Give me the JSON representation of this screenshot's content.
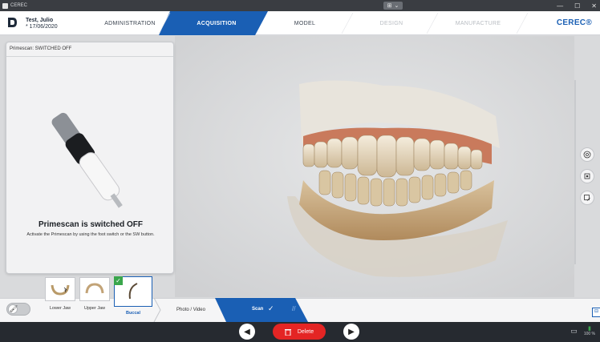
{
  "titlebar": {
    "app_name": "CEREC",
    "min_label": "—",
    "max_label": "☐",
    "close_label": "✕"
  },
  "patient": {
    "name": "Test, Julio",
    "dob": "* 17/06/2020"
  },
  "workflow": {
    "steps": [
      {
        "label": "ADMINISTRATION",
        "state": "normal"
      },
      {
        "label": "ACQUISITION",
        "state": "active"
      },
      {
        "label": "MODEL",
        "state": "normal"
      },
      {
        "label": "DESIGN",
        "state": "disabled"
      },
      {
        "label": "MANUFACTURE",
        "state": "disabled"
      }
    ],
    "brand": "CEREC®"
  },
  "panel": {
    "header": "Primescan: SWITCHED OFF",
    "title": "Primescan is switched OFF",
    "description": "Activate the Primescan by using the foot switch or the SW button."
  },
  "catalog": {
    "items": [
      {
        "label": "Lower Jaw",
        "selected": false
      },
      {
        "label": "Upper Jaw",
        "selected": false
      },
      {
        "label": "Buccal",
        "selected": true
      }
    ],
    "photo_tab": "Photo / Video",
    "scan_tab": "Scan"
  },
  "actions": {
    "delete_label": "Delete"
  },
  "tray": {
    "battery": "100 %"
  },
  "colors": {
    "accent": "#1a5fb4",
    "delete": "#e42524",
    "check": "#3aa64c"
  }
}
